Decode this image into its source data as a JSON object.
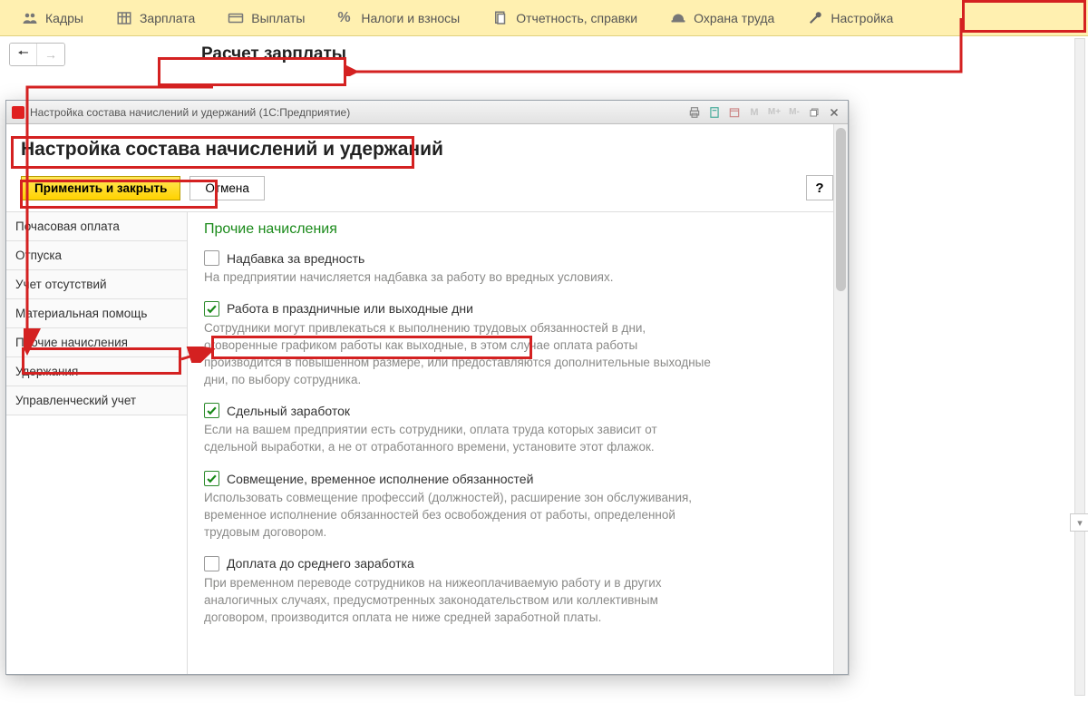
{
  "topnav": {
    "items": [
      {
        "icon": "people",
        "label": "Кадры"
      },
      {
        "icon": "table",
        "label": "Зарплата"
      },
      {
        "icon": "card",
        "label": "Выплаты"
      },
      {
        "icon": "percent",
        "label": "Налоги и взносы"
      },
      {
        "icon": "doc",
        "label": "Отчетность, справки"
      },
      {
        "icon": "helmet",
        "label": "Охрана труда"
      },
      {
        "icon": "wrench",
        "label": "Настройка"
      }
    ]
  },
  "subbar": {
    "title": "Расчет зарплаты"
  },
  "dialog": {
    "titlebar": "Настройка состава начислений и удержаний  (1С:Предприятие)",
    "header": "Настройка состава начислений и удержаний",
    "apply": "Применить и закрыть",
    "cancel": "Отмена",
    "help": "?",
    "sidebar": [
      "Почасовая оплата",
      "Отпуска",
      "Учет отсутствий",
      "Материальная помощь",
      "Прочие начисления",
      "Удержания",
      "Управленческий учет"
    ],
    "section_title": "Прочие начисления",
    "options": [
      {
        "checked": false,
        "label": "Надбавка за вредность",
        "desc": "На предприятии начисляется надбавка за работу во вредных условиях."
      },
      {
        "checked": true,
        "label": "Работа в праздничные или выходные дни",
        "desc": "Сотрудники могут привлекаться к выполнению трудовых обязанностей в дни, оговоренные графиком работы как выходные, в этом случае оплата работы производится в повышенном размере, или предоставляются дополнительные выходные дни, по выбору сотрудника."
      },
      {
        "checked": true,
        "label": "Сдельный заработок",
        "desc": "Если на вашем предприятии есть сотрудники, оплата труда которых зависит от сдельной выработки, а не от отработанного времени, установите этот флажок."
      },
      {
        "checked": true,
        "label": "Совмещение, временное исполнение обязанностей",
        "desc": "Использовать совмещение профессий (должностей), расширение зон обслуживания, временное исполнение обязанностей без освобождения от работы, определенной трудовым договором."
      },
      {
        "checked": false,
        "label": "Доплата до среднего заработка",
        "desc": "При временном переводе сотрудников на нижеоплачиваемую работу и в других аналогичных случаях, предусмотренных законодательством или коллективным договором, производится оплата не ниже средней заработной платы."
      }
    ]
  }
}
